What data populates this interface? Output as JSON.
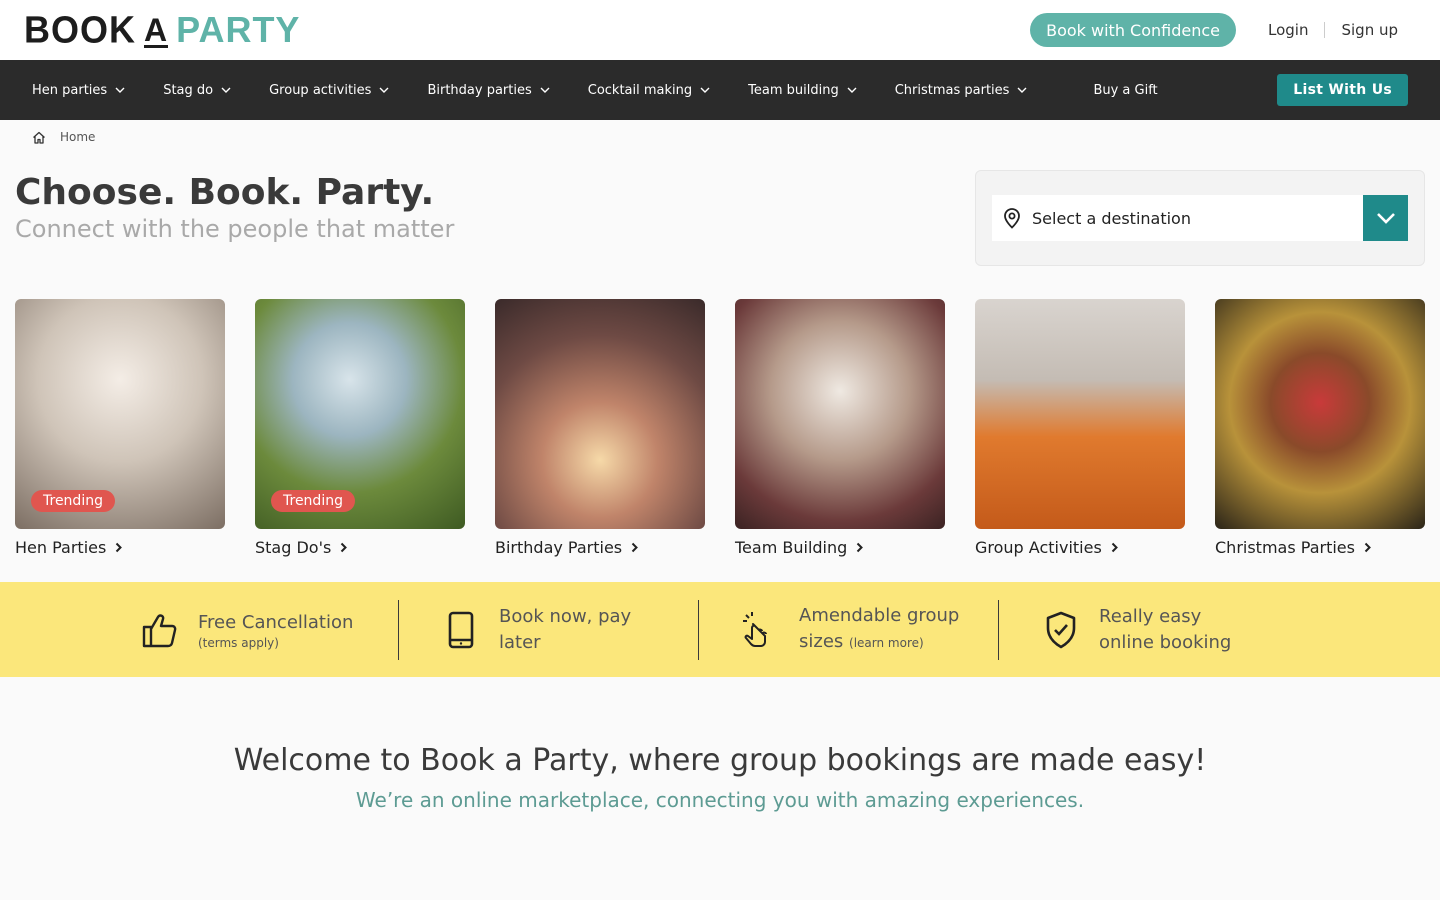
{
  "brand": {
    "part1": "BOOK",
    "part2": "A",
    "part3": "PARTY"
  },
  "header": {
    "confidence": "Book with Confidence",
    "login": "Login",
    "signup": "Sign up"
  },
  "nav": {
    "items": [
      "Hen parties",
      "Stag do",
      "Group activities",
      "Birthday parties",
      "Cocktail making",
      "Team building",
      "Christmas parties"
    ],
    "gift": "Buy a Gift",
    "list_with_us": "List With Us"
  },
  "breadcrumb": {
    "home": "Home"
  },
  "hero": {
    "title": "Choose. Book. Party.",
    "subtitle": "Connect with the people that matter"
  },
  "destination": {
    "placeholder": "Select a destination"
  },
  "cards": [
    {
      "label": "Hen Parties",
      "badge": "Trending"
    },
    {
      "label": "Stag Do's",
      "badge": "Trending"
    },
    {
      "label": "Birthday Parties",
      "badge": ""
    },
    {
      "label": "Team Building",
      "badge": ""
    },
    {
      "label": "Group Activities",
      "badge": ""
    },
    {
      "label": "Christmas Parties",
      "badge": ""
    }
  ],
  "features": [
    {
      "line1": "Free Cancellation",
      "small": "(terms apply)",
      "icon": "thumbs-up-icon"
    },
    {
      "line1": "Book now, pay",
      "line2": "later",
      "icon": "mobile-phone-icon"
    },
    {
      "line1": "Amendable group",
      "line2": "sizes",
      "small": "(learn more)",
      "icon": "pointing-hand-icon"
    },
    {
      "line1": "Really easy",
      "line2": "online booking",
      "icon": "shield-check-icon"
    }
  ],
  "welcome": {
    "title": "Welcome to Book a Party, where group bookings are made easy!",
    "subtitle": "We’re an online marketplace, connecting you with amazing experiences."
  },
  "colors": {
    "teal": "#1f8a8a",
    "accent": "#5fb3a8",
    "yellow": "#fbe77b",
    "badge": "#e0564f",
    "nav": "#2b2b2b"
  }
}
